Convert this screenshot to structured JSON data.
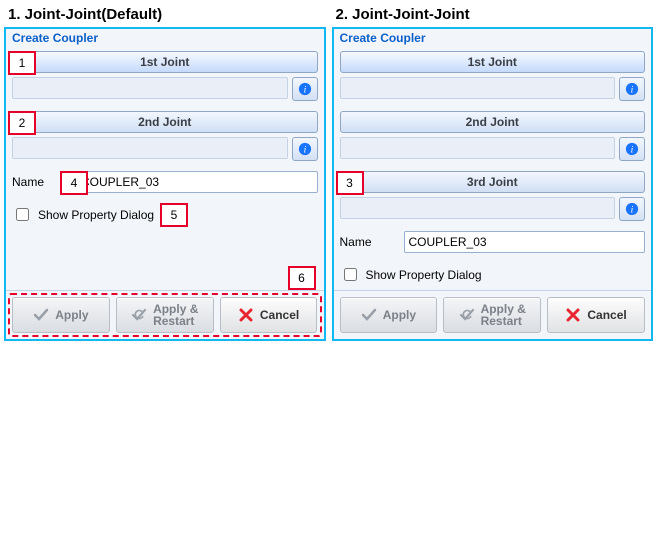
{
  "left": {
    "title": "1.   Joint-Joint(Default)",
    "header": "Create Coupler",
    "joint1_label": "1st Joint",
    "joint2_label": "2nd Joint",
    "name_label": "Name",
    "name_value": "COUPLER_03",
    "show_property_label": "Show Property Dialog",
    "callouts": {
      "c1": "1",
      "c2": "2",
      "c4": "4",
      "c5": "5",
      "c6": "6"
    },
    "footer": {
      "apply": "Apply",
      "apply_restart_1": "Apply &",
      "apply_restart_2": "Restart",
      "cancel": "Cancel"
    }
  },
  "right": {
    "title": "2. Joint-Joint-Joint",
    "header": "Create Coupler",
    "joint1_label": "1st Joint",
    "joint2_label": "2nd Joint",
    "joint3_label": "3rd Joint",
    "name_label": "Name",
    "name_value": "COUPLER_03",
    "show_property_label": "Show Property Dialog",
    "callouts": {
      "c3": "3"
    },
    "footer": {
      "apply": "Apply",
      "apply_restart_1": "Apply &",
      "apply_restart_2": "Restart",
      "cancel": "Cancel"
    }
  },
  "icons": {
    "info": "info-icon",
    "check": "check-icon",
    "check_restart": "check-restart-icon",
    "cancel": "cancel-icon"
  }
}
